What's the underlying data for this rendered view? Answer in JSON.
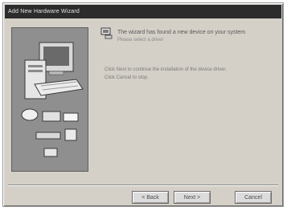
{
  "window": {
    "title": "Add New Hardware Wizard"
  },
  "content": {
    "heading": "The wizard has found a new device on your system",
    "subheading": "Please select a driver",
    "body_lines": [
      "Click Next to continue the installation of the device driver.",
      "Click Cancel to stop."
    ]
  },
  "buttons": {
    "back": "< Back",
    "next": "Next >",
    "cancel": "Cancel"
  },
  "icons": {
    "header": "hardware-icon",
    "side_computer": "computer-icon",
    "side_peripherals": "peripheral-devices-icon"
  }
}
